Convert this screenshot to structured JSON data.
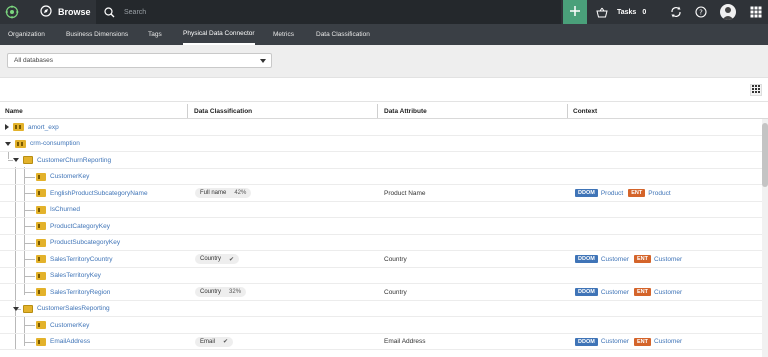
{
  "topbar": {
    "browse_label": "Browse",
    "search_placeholder": "Search",
    "tasks_label": "Tasks",
    "tasks_count": "0"
  },
  "tabs": [
    {
      "label": "Organization"
    },
    {
      "label": "Business Dimensions"
    },
    {
      "label": "Tags"
    },
    {
      "label": "Physical Data Connector"
    },
    {
      "label": "Metrics"
    },
    {
      "label": "Data Classification"
    }
  ],
  "filter": {
    "database_select": "All databases"
  },
  "table": {
    "headers": [
      "Name",
      "Data Classification",
      "Data Attribute",
      "Context"
    ],
    "rows": [
      {
        "name": "amort_exp"
      },
      {
        "name": "crm-consumption"
      },
      {
        "name": "CustomerChurnReporting"
      },
      {
        "name": "CustomerKey"
      },
      {
        "name": "EnglishProductSubcategoryName",
        "class_label": "Full name",
        "class_value": "42%",
        "attribute": "Product Name",
        "ddom": "DDOM",
        "ddom_value": "Product",
        "ent": "ENT",
        "ent_value": "Product"
      },
      {
        "name": "IsChurned"
      },
      {
        "name": "ProductCategoryKey"
      },
      {
        "name": "ProductSubcategoryKey"
      },
      {
        "name": "SalesTerritoryCountry",
        "class_label": "Country",
        "class_value": "✔",
        "attribute": "Country",
        "ddom": "DDOM",
        "ddom_value": "Customer",
        "ent": "ENT",
        "ent_value": "Customer"
      },
      {
        "name": "SalesTerritoryKey"
      },
      {
        "name": "SalesTerritoryRegion",
        "class_label": "Country",
        "class_value": "32%",
        "attribute": "Country",
        "ddom": "DDOM",
        "ddom_value": "Customer",
        "ent": "ENT",
        "ent_value": "Customer"
      },
      {
        "name": "CustomerSalesReporting"
      },
      {
        "name": "CustomerKey"
      },
      {
        "name": "EmailAddress",
        "class_label": "Email",
        "class_value": "✔",
        "attribute": "Email Address",
        "ddom": "DDOM",
        "ddom_value": "Customer",
        "ent": "ENT",
        "ent_value": "Customer"
      }
    ]
  }
}
